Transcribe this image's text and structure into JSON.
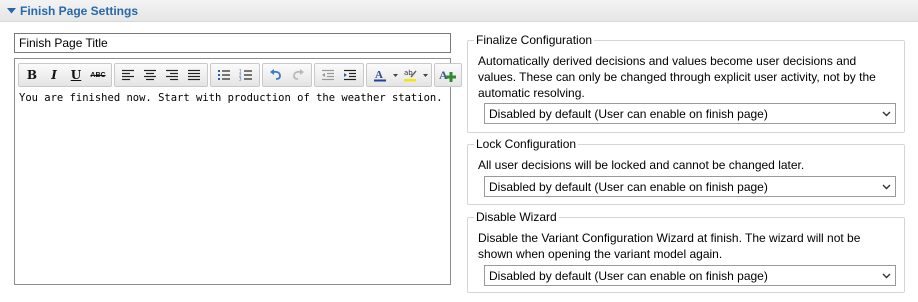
{
  "section": {
    "title": "Finish Page Settings"
  },
  "title_field": {
    "value": "Finish Page Title"
  },
  "editor": {
    "content": "You are finished now. Start with production of the weather station."
  },
  "finalize": {
    "label": "Finalize Configuration",
    "description": "Automatically derived decisions and values become user decisions and values. These can only be changed through explicit user activity, not by the automatic resolving.",
    "selected": "Disabled by default (User can enable on finish page)"
  },
  "lock": {
    "label": "Lock Configuration",
    "description": "All user decisions will be locked and cannot be changed later.",
    "selected": "Disabled by default (User can enable on finish page)"
  },
  "disable_wizard": {
    "label": "Disable Wizard",
    "description": "Disable the Variant Configuration Wizard at finish. The wizard will not be shown when opening the variant model again.",
    "selected": "Disabled by default (User can enable on finish page)"
  },
  "toolbar": {
    "bold": "B",
    "italic": "I",
    "underline": "U",
    "strike": "ABC",
    "icons": [
      "bold-icon",
      "italic-icon",
      "underline-icon",
      "strikethrough-icon",
      "align-left-icon",
      "align-center-icon",
      "align-right-icon",
      "justify-icon",
      "bullet-list-icon",
      "numbered-list-icon",
      "undo-icon",
      "redo-icon",
      "outdent-icon",
      "indent-icon",
      "font-color-icon",
      "highlight-color-icon",
      "insert-variable-icon"
    ]
  },
  "colors": {
    "header_text": "#2668a8",
    "insert_plus": "#2e8b2e",
    "undo": "#3c78c8"
  }
}
